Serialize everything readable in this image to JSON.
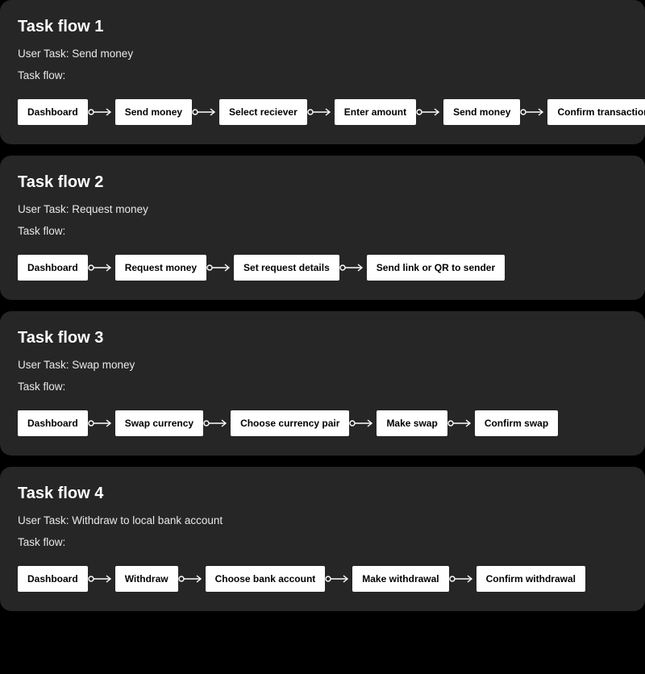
{
  "flows": [
    {
      "title": "Task flow 1",
      "user_task_label": "User Task: Send money",
      "flow_label": "Task flow:",
      "steps": [
        "Dashboard",
        "Send money",
        "Select reciever",
        "Enter amount",
        "Send money",
        "Confirm transaction"
      ]
    },
    {
      "title": "Task flow 2",
      "user_task_label": "User Task: Request money",
      "flow_label": "Task flow:",
      "steps": [
        "Dashboard",
        "Request money",
        "Set request details",
        "Send link or QR to sender"
      ]
    },
    {
      "title": "Task flow 3",
      "user_task_label": "User Task: Swap money",
      "flow_label": "Task flow:",
      "steps": [
        "Dashboard",
        "Swap currency",
        "Choose currency pair",
        "Make swap",
        "Confirm swap"
      ]
    },
    {
      "title": "Task flow 4",
      "user_task_label": "User Task: Withdraw to local bank account",
      "flow_label": "Task flow:",
      "steps": [
        "Dashboard",
        "Withdraw",
        "Choose bank account",
        "Make withdrawal",
        "Confirm withdrawal"
      ]
    }
  ]
}
